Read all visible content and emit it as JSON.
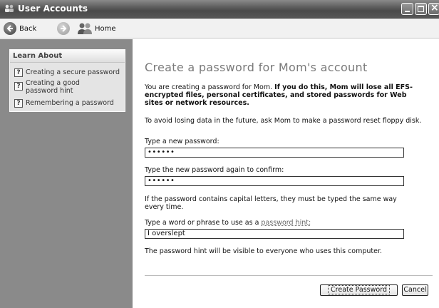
{
  "window": {
    "title": "User Accounts"
  },
  "toolbar": {
    "back_label": "Back",
    "home_label": "Home"
  },
  "sidebar": {
    "panel_title": "Learn About",
    "items": [
      {
        "label": "Creating a secure password",
        "icon": "help-icon"
      },
      {
        "label": "Creating a good password hint",
        "icon": "help-icon"
      },
      {
        "label": "Remembering a password",
        "icon": "help-icon"
      }
    ]
  },
  "main": {
    "heading": "Create a password for Mom's account",
    "intro_plain": "You are creating a password for Mom. ",
    "intro_bold": "If you do this, Mom will lose all EFS-encrypted files, personal certificates, and stored passwords for Web sites or network resources.",
    "avoid_text": "To avoid losing data in the future, ask Mom to make a password reset floppy disk.",
    "new_password_label": "Type a new password:",
    "new_password_value": "••••••",
    "confirm_label": "Type the new password again to confirm:",
    "confirm_value": "••••••",
    "caps_note": "If the password contains capital letters, they must be typed the same way every time.",
    "hint_label_prefix": "Type a word or phrase to use as a ",
    "hint_link": "password hint:",
    "hint_value": "I overslept",
    "hint_note": "The password hint will be visible to everyone who uses this computer.",
    "create_button": "Create Password",
    "cancel_button": "Cancel"
  }
}
